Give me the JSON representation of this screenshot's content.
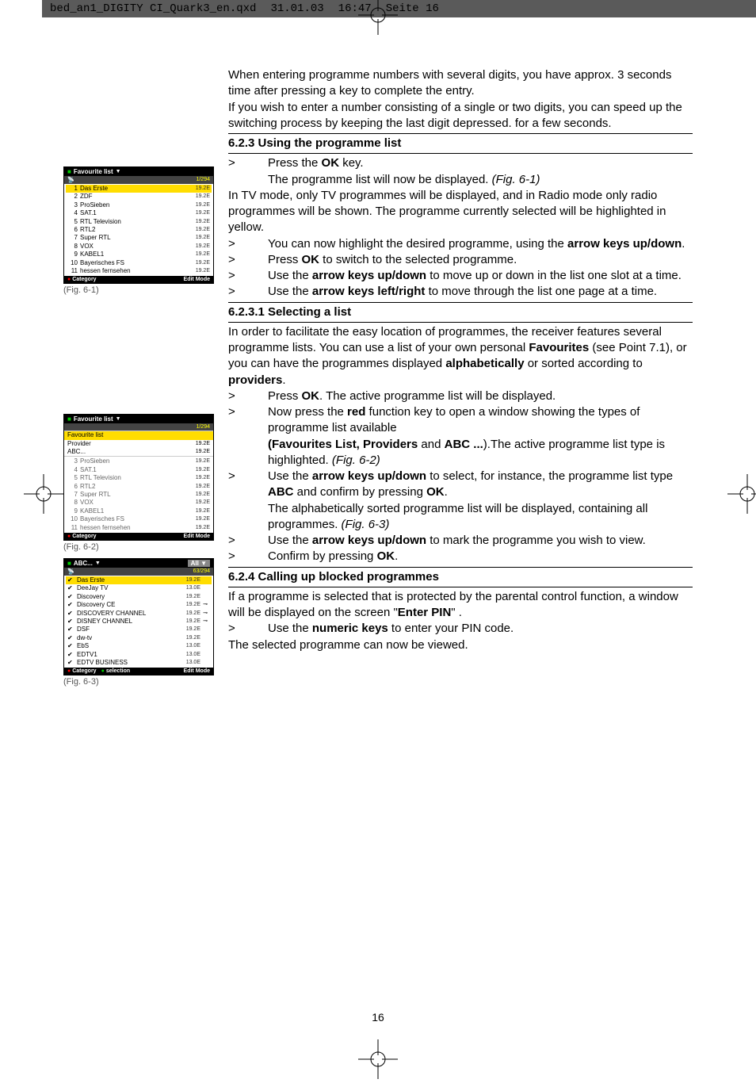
{
  "header": {
    "filename": "bed_an1_DIGITY CI_Quark3_en.qxd",
    "date": "31.01.03",
    "time": "16:47",
    "page": "Seite 16"
  },
  "intro": {
    "p1": "When entering programme numbers with several digits, you have approx. 3 seconds time after pressing a key to complete the entry.",
    "p2": "If you wish to enter a number consisting of a single or two digits, you can speed up the switching process by keeping the last digit depressed. for a few seconds."
  },
  "section623": {
    "title": "6.2.3 Using the programme list",
    "step1a": "Press the ",
    "step1b": "OK",
    "step1c": " key.",
    "line2a": "The programme list will now be displayed. ",
    "line2b": "(Fig. 6-1)",
    "line3": "In TV mode, only TV programmes will be displayed, and in Radio mode only radio programmes will be shown. The programme currently selected will be highlighted in yellow.",
    "step2a": "You can now highlight the desired programme, using the ",
    "step2b": "arrow keys up/down",
    "step2c": ".",
    "step3a": "Press ",
    "step3b": "OK",
    "step3c": " to switch to the selected programme.",
    "step4a": "Use the ",
    "step4b": "arrow keys up/down",
    "step4c": " to move up or down in the list one slot at a time.",
    "step5a": "Use the ",
    "step5b": "arrow keys left/right",
    "step5c": " to move through the list one page at a time."
  },
  "section6231": {
    "title": "6.2.3.1 Selecting a list",
    "p1a": "In order to facilitate the easy location of programmes, the receiver features several programme lists. You can use a list of your own personal ",
    "p1b": "Favourites",
    "p1c": " (see Point 7.1), or you can have the programmes displayed  ",
    "p1d": "alphabetically",
    "p1e": " or sorted according to ",
    "p1f": "providers",
    "p1g": ".",
    "step1a": "Press ",
    "step1b": "OK",
    "step1c": ". The active programme list will be displayed.",
    "step2a": "Now press the ",
    "step2b": "red",
    "step2c": " function key to open a window showing the types of programme list available",
    "step2d": "(Favourites List, ",
    "step2e": "Providers",
    "step2f": " and ",
    "step2g": "ABC ...",
    "step2h": ").The active programme list type is highlighted. ",
    "step2i": "(Fig. 6-2)",
    "step3a": "Use the ",
    "step3b": "arrow keys up/down",
    "step3c": " to select, for instance, the programme list type ",
    "step3d": "ABC",
    "step3e": "   and confirm by pressing ",
    "step3f": "OK",
    "step3g": ".",
    "step3h": "The alphabetically sorted programme list will be displayed, containing all programmes. ",
    "step3i": "(Fig. 6-3)",
    "step4a": "Use the ",
    "step4b": "arrow keys up/down",
    "step4c": " to mark the programme you wish to view.",
    "step5a": "Confirm by pressing ",
    "step5b": "OK",
    "step5c": "."
  },
  "section624": {
    "title": "6.2.4 Calling up blocked programmes",
    "p1a": "If a programme is selected that is protected by the parental control function, a window will be displayed on the screen \"",
    "p1b": "Enter PIN",
    "p1c": "\" .",
    "step1a": "Use the ",
    "step1b": "numeric keys",
    "step1c": " to enter your PIN code.",
    "p2": "The selected programme can now be viewed."
  },
  "fig61": {
    "header": "Favourite list",
    "count": "1/294",
    "rows": [
      {
        "num": "1",
        "name": "Das Erste",
        "freq": "19.2E"
      },
      {
        "num": "2",
        "name": "ZDF",
        "freq": "19.2E"
      },
      {
        "num": "3",
        "name": "ProSieben",
        "freq": "19.2E"
      },
      {
        "num": "4",
        "name": "SAT.1",
        "freq": "19.2E"
      },
      {
        "num": "5",
        "name": "RTL Television",
        "freq": "19.2E"
      },
      {
        "num": "6",
        "name": "RTL2",
        "freq": "19.2E"
      },
      {
        "num": "7",
        "name": "Super RTL",
        "freq": "19.2E"
      },
      {
        "num": "8",
        "name": "VOX",
        "freq": "19.2E"
      },
      {
        "num": "9",
        "name": "KABEL1",
        "freq": "19.2E"
      },
      {
        "num": "10",
        "name": "Bayerisches FS",
        "freq": "19.2E"
      },
      {
        "num": "11",
        "name": "hessen fernsehen",
        "freq": "19.2E"
      }
    ],
    "footer_left": "Category",
    "footer_right": "Edit Mode",
    "caption": "(Fig. 6-1)"
  },
  "fig62": {
    "header": "Favourite list",
    "count": "1/294",
    "provider_rows": [
      {
        "name": "Favourite list",
        "freq": ""
      },
      {
        "name": "Provider",
        "freq": "19.2E"
      },
      {
        "name": "ABC...",
        "freq": "19.2E"
      }
    ],
    "rows": [
      {
        "num": "3",
        "name": "ProSieben",
        "freq": "19.2E"
      },
      {
        "num": "4",
        "name": "SAT.1",
        "freq": "19.2E"
      },
      {
        "num": "5",
        "name": "RTL Television",
        "freq": "19.2E"
      },
      {
        "num": "6",
        "name": "RTL2",
        "freq": "19.2E"
      },
      {
        "num": "7",
        "name": "Super RTL",
        "freq": "19.2E"
      },
      {
        "num": "8",
        "name": "VOX",
        "freq": "19.2E"
      },
      {
        "num": "9",
        "name": "KABEL1",
        "freq": "19.2E"
      },
      {
        "num": "10",
        "name": "Bayerisches FS",
        "freq": "19.2E"
      },
      {
        "num": "11",
        "name": "hessen fernsehen",
        "freq": "19.2E"
      }
    ],
    "footer_left": "Category",
    "footer_right": "Edit Mode",
    "caption": "(Fig. 6-2)"
  },
  "fig63": {
    "header": "ABC...",
    "header_right": "All",
    "count": "63/294",
    "rows": [
      {
        "name": "Das Erste",
        "freq": "19.2E",
        "lock": ""
      },
      {
        "name": "DeeJay TV",
        "freq": "13.0E",
        "lock": ""
      },
      {
        "name": "Discovery",
        "freq": "19.2E",
        "lock": ""
      },
      {
        "name": "Discovery CE",
        "freq": "19.2E",
        "lock": "⊸"
      },
      {
        "name": "DISCOVERY CHANNEL",
        "freq": "19.2E",
        "lock": "⊸"
      },
      {
        "name": "DISNEY CHANNEL",
        "freq": "19.2E",
        "lock": "⊸"
      },
      {
        "name": "DSF",
        "freq": "19.2E",
        "lock": ""
      },
      {
        "name": "dw-tv",
        "freq": "19.2E",
        "lock": ""
      },
      {
        "name": "EbS",
        "freq": "13.0E",
        "lock": ""
      },
      {
        "name": "EDTV1",
        "freq": "13.0E",
        "lock": ""
      },
      {
        "name": "EDTV BUSINESS",
        "freq": "13.0E",
        "lock": ""
      }
    ],
    "footer_left": "Category",
    "footer_mid": "selection",
    "footer_right": "Edit Mode",
    "caption": "(Fig. 6-3)"
  },
  "pagenum": "16"
}
